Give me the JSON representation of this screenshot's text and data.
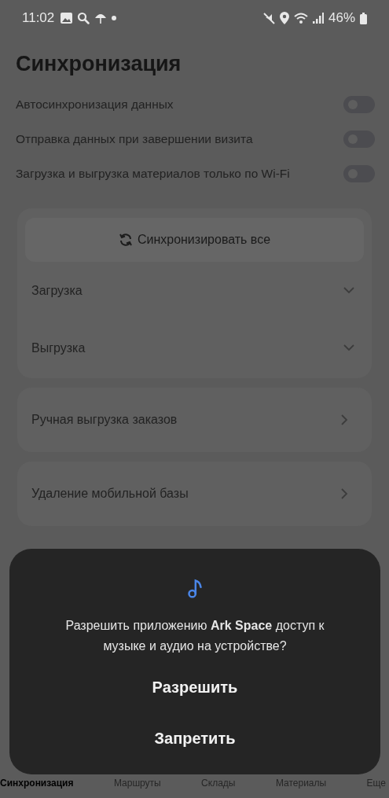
{
  "status_bar": {
    "time": "11:02",
    "battery": "46%"
  },
  "title": "Синхронизация",
  "toggles": [
    {
      "label": "Автосинхронизация данных",
      "on": false
    },
    {
      "label": "Отправка данных при завершении визита",
      "on": false
    },
    {
      "label": "Загрузка и выгрузка материалов только по Wi-Fi",
      "on": false
    }
  ],
  "sync_card": {
    "button": "Синхронизировать все",
    "sections": [
      {
        "label": "Загрузка",
        "expanded": false
      },
      {
        "label": "Выгрузка",
        "expanded": false
      }
    ]
  },
  "links": [
    "Ручная выгрузка заказов",
    "Удаление мобильной базы"
  ],
  "dialog": {
    "message": "Разрешить приложению **Ark Space** доступ к музыке и аудио на устройстве?",
    "buttons": [
      "Разрешить",
      "Запретить"
    ]
  },
  "bottom_nav": [
    {
      "label": "Синхронизация",
      "selected": true
    },
    {
      "label": "Маршруты",
      "selected": false
    },
    {
      "label": "Склады",
      "selected": false
    },
    {
      "label": "Материалы",
      "selected": false
    },
    {
      "label": "Еще",
      "selected": false
    }
  ]
}
